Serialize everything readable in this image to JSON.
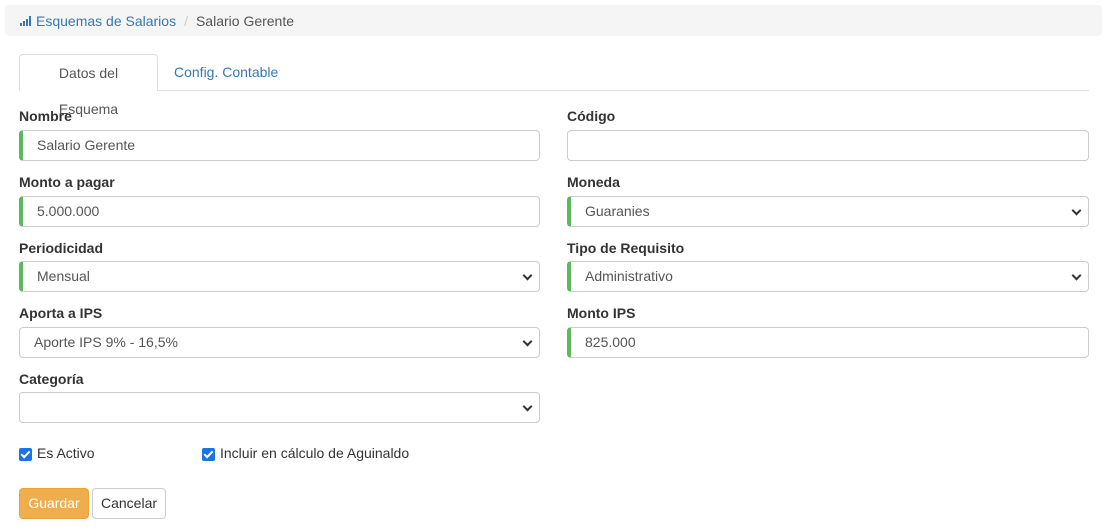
{
  "breadcrumb": {
    "icon": "signal-bars-icon",
    "parent": "Esquemas de Salarios",
    "separator": "/",
    "current": "Salario Gerente"
  },
  "tabs": [
    {
      "label": "Datos del Esquema",
      "active": true
    },
    {
      "label": "Config. Contable",
      "active": false
    }
  ],
  "form": {
    "nombre": {
      "label": "Nombre",
      "value": "Salario Gerente"
    },
    "codigo": {
      "label": "Código",
      "value": ""
    },
    "monto": {
      "label": "Monto a pagar",
      "value": "5.000.000"
    },
    "moneda": {
      "label": "Moneda",
      "value": "Guaranies"
    },
    "periodicidad": {
      "label": "Periodicidad",
      "value": "Mensual"
    },
    "tipo_requisito": {
      "label": "Tipo de Requisito",
      "value": "Administrativo"
    },
    "aporta_ips": {
      "label": "Aporta a IPS",
      "value": "Aporte IPS 9% - 16,5%"
    },
    "monto_ips": {
      "label": "Monto IPS",
      "value": "825.000"
    },
    "categoria": {
      "label": "Categoría",
      "value": ""
    }
  },
  "checkboxes": {
    "es_activo": {
      "label": "Es Activo",
      "checked": true
    },
    "aguinaldo": {
      "label": "Incluir en cálculo de Aguinaldo",
      "checked": true
    }
  },
  "buttons": {
    "save": "Guardar",
    "cancel": "Cancelar"
  },
  "colors": {
    "link": "#337ab7",
    "required_border": "#5cb85c",
    "primary_button": "#f0ad4e",
    "checkbox": "#1a73e8"
  }
}
